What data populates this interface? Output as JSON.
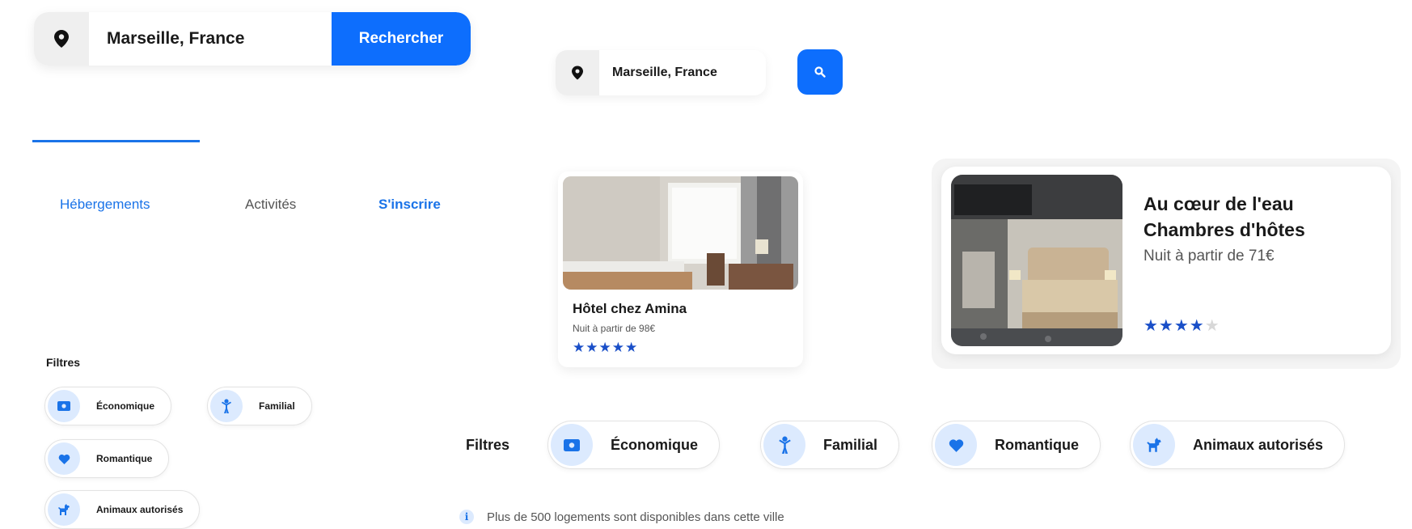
{
  "search_large": {
    "location": "Marseille, France",
    "button_label": "Rechercher"
  },
  "search_small": {
    "location": "Marseille, France"
  },
  "nav": {
    "items": [
      "Hébergements",
      "Activités",
      "S'inscrire"
    ]
  },
  "filters_vertical": {
    "title": "Filtres",
    "chips": [
      "Économique",
      "Familial",
      "Romantique",
      "Animaux autorisés"
    ]
  },
  "filters_horizontal": {
    "title": "Filtres",
    "chips": [
      "Économique",
      "Familial",
      "Romantique",
      "Animaux autorisés"
    ]
  },
  "card_small": {
    "name": "Hôtel chez Amina",
    "price": "Nuit à partir de 98€",
    "stars_text": "★★★★★",
    "rating": 5
  },
  "card_large": {
    "title": "Au cœur de l'eau Chambres d'hôtes",
    "price": "Nuit à partir de 71€",
    "stars_on": "★★★★",
    "stars_off": "★",
    "rating": 4
  },
  "info": {
    "icon_letter": "i",
    "text": "Plus de 500 logements sont disponibles dans cette ville"
  },
  "colors": {
    "accent": "#0d6efd",
    "chip_icon_bg": "#dceafe",
    "star": "#1a4fc8"
  }
}
